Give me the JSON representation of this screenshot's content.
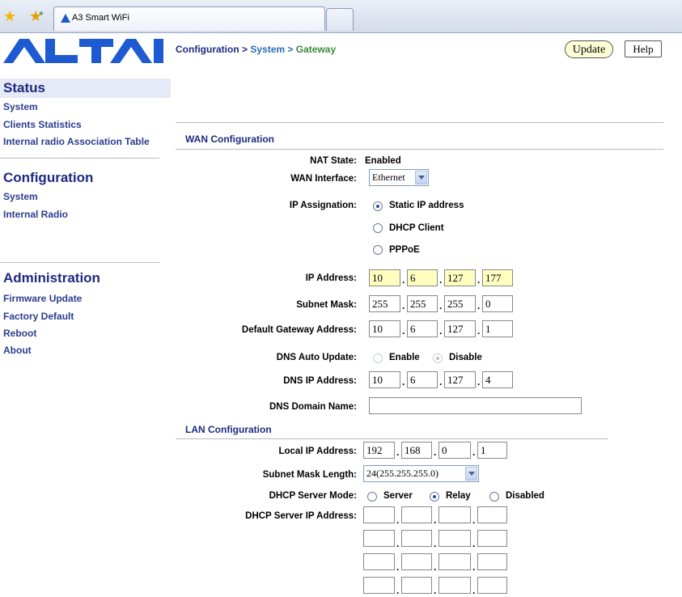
{
  "browser": {
    "tab_title": "A3 Smart WiFi"
  },
  "logo": {
    "text": "ALTAI"
  },
  "sidebar": {
    "status": {
      "title": "Status",
      "items": [
        "System",
        "Clients Statistics",
        "Internal radio Association Table"
      ]
    },
    "configuration": {
      "title": "Configuration",
      "items": [
        "System",
        "Internal Radio"
      ]
    },
    "administration": {
      "title": "Administration",
      "items": [
        "Firmware Update",
        "Factory Default",
        "Reboot",
        "About"
      ]
    }
  },
  "header": {
    "crumb_config": "Configuration",
    "sep": ">",
    "crumb_system": "System",
    "crumb_gateway": "Gateway",
    "update_label": "Update",
    "help_label": "Help"
  },
  "wan": {
    "title": "WAN Configuration",
    "nat_label": "NAT State:",
    "nat_value": "Enabled",
    "interface_label": "WAN Interface:",
    "interface_value": "Ethernet",
    "ip_assign_label": "IP Assignation:",
    "ip_assign_options": [
      "Static IP address",
      "DHCP Client",
      "PPPoE"
    ],
    "ip_assign_selected": "Static IP address",
    "ip_label": "IP Address:",
    "ip": [
      "10",
      "6",
      "127",
      "177"
    ],
    "mask_label": "Subnet Mask:",
    "mask": [
      "255",
      "255",
      "255",
      "0"
    ],
    "gateway_label": "Default Gateway Address:",
    "gateway": [
      "10",
      "6",
      "127",
      "1"
    ],
    "dns_auto_label": "DNS Auto Update:",
    "dns_auto_options": [
      "Enable",
      "Disable"
    ],
    "dns_auto_selected": "Disable",
    "dns_ip_label": "DNS IP Address:",
    "dns_ip": [
      "10",
      "6",
      "127",
      "4"
    ],
    "dns_domain_label": "DNS Domain Name:",
    "dns_domain": ""
  },
  "lan": {
    "title": "LAN Configuration",
    "local_ip_label": "Local IP Address:",
    "local_ip": [
      "192",
      "168",
      "0",
      "1"
    ],
    "mask_len_label": "Subnet Mask Length:",
    "mask_len_value": "24(255.255.255.0)",
    "dhcp_mode_label": "DHCP Server Mode:",
    "dhcp_mode_options": [
      "Server",
      "Relay",
      "Disabled"
    ],
    "dhcp_mode_selected": "Relay",
    "dhcp_ip_label": "DHCP Server IP Address:",
    "dhcp_ips": [
      [
        "",
        "",
        "",
        ""
      ],
      [
        "",
        "",
        "",
        ""
      ],
      [
        "",
        "",
        "",
        ""
      ],
      [
        "",
        "",
        "",
        ""
      ]
    ]
  }
}
